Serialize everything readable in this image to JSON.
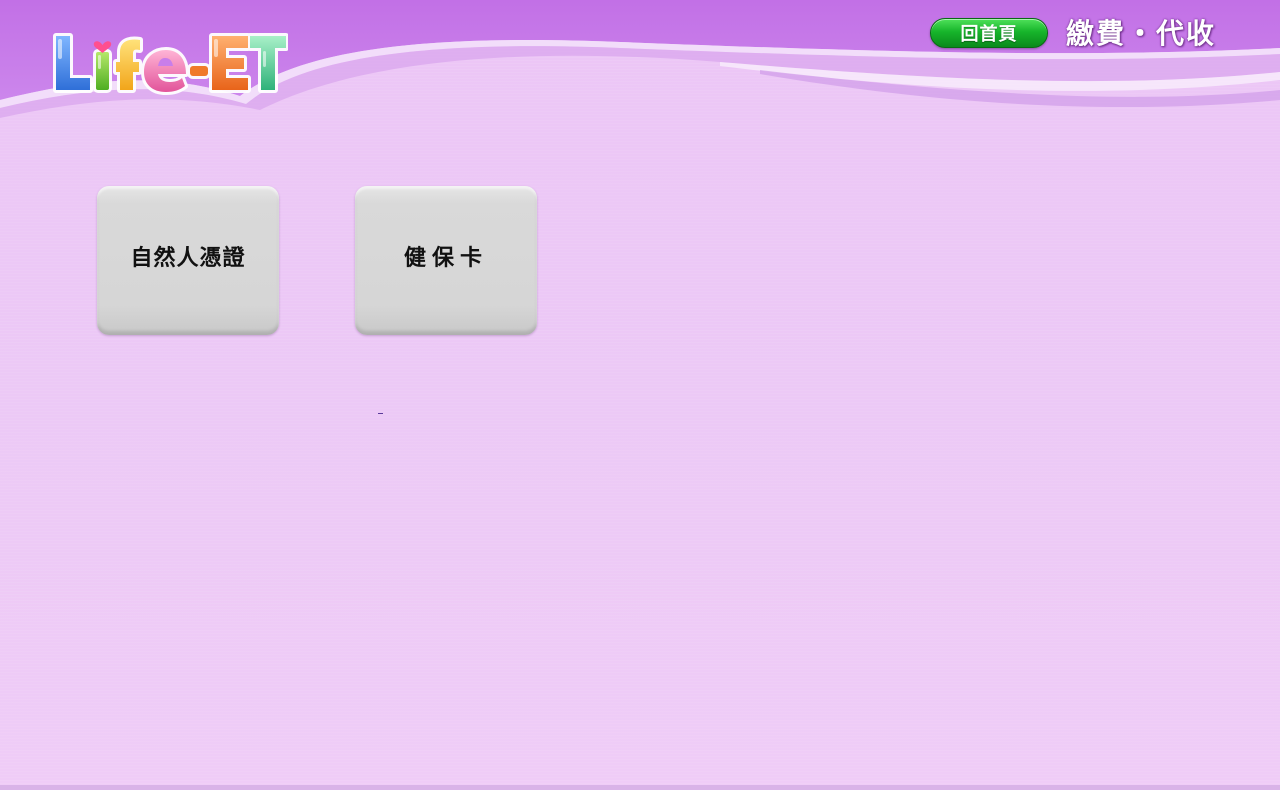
{
  "header": {
    "logo_text": "Life-ET",
    "home_button_label": "回首頁",
    "page_title": "繳費・代收"
  },
  "tiles": [
    {
      "label": "自然人憑證"
    },
    {
      "label": "健保卡"
    }
  ],
  "colors": {
    "background": "#ecc9f6",
    "header": "#c77ee8",
    "home_button": "#17b52b",
    "tile": "#d6d6d6"
  }
}
